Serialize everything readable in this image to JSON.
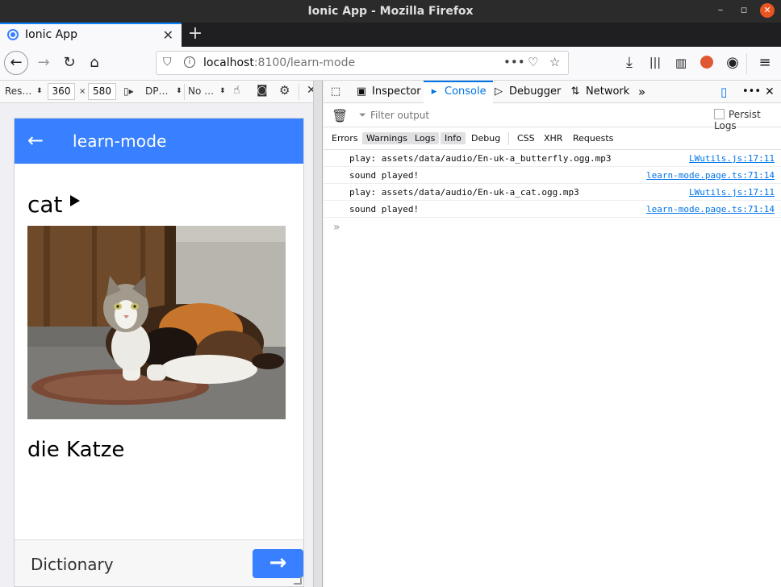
{
  "window": {
    "title": "Ionic App - Mozilla Firefox"
  },
  "tab": {
    "label": "Ionic App"
  },
  "url": {
    "host": "localhost",
    "rest": ":8100/learn-mode"
  },
  "rdm": {
    "device": "Res…",
    "width": "360",
    "times": "×",
    "height": "580",
    "dpr": "DP…",
    "throttle": "No …"
  },
  "devtools": {
    "tabs": [
      {
        "label": "Inspector"
      },
      {
        "label": "Console"
      },
      {
        "label": "Debugger"
      },
      {
        "label": "Network"
      }
    ],
    "filter_placeholder": "Filter output",
    "persist_label": "Persist Logs",
    "filters": [
      "Errors",
      "Warnings",
      "Logs",
      "Info",
      "Debug",
      "CSS",
      "XHR",
      "Requests"
    ],
    "logs": [
      {
        "message": "play: assets/data/audio/En-uk-a_butterfly.ogg.mp3",
        "source": "LWutils.js:17:11"
      },
      {
        "message": "sound played!",
        "source": "learn-mode.page.ts:71:14"
      },
      {
        "message": "play: assets/data/audio/En-uk-a_cat.ogg.mp3",
        "source": "LWutils.js:17:11"
      },
      {
        "message": "sound played!",
        "source": "learn-mode.page.ts:71:14"
      }
    ],
    "prompt": "»"
  },
  "app": {
    "header_title": "learn-mode",
    "word": "cat",
    "translation": "die Katze",
    "footer_label": "Dictionary",
    "next_arrow": "→",
    "brand_color": "#3880ff"
  }
}
